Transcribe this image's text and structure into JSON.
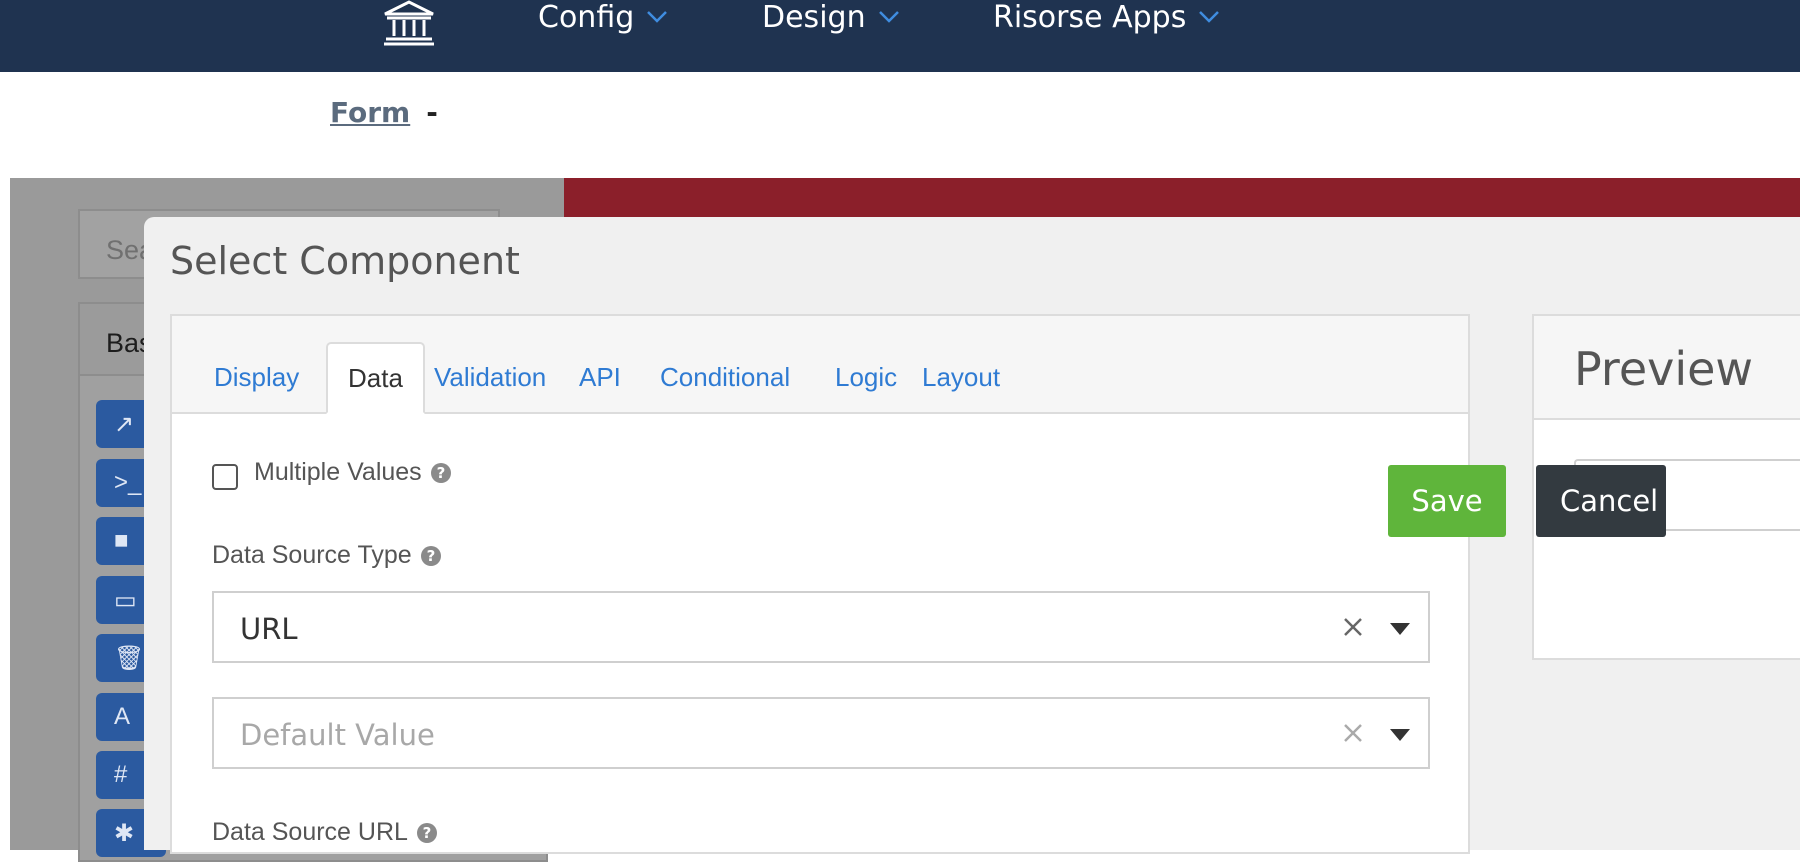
{
  "navbar": {
    "logo_icon": "bank-icon",
    "items": [
      {
        "label": "Config"
      },
      {
        "label": "Design"
      },
      {
        "label": "Risorse Apps"
      }
    ]
  },
  "breadcrumb": {
    "link": "Form",
    "separator": "-"
  },
  "builder": {
    "search_placeholder": "Sea",
    "group_label": "Bas",
    "component_icons": [
      {
        "icon": "external-link-icon",
        "glyph": "↗"
      },
      {
        "icon": "terminal-icon",
        "glyph": ">_"
      },
      {
        "icon": "square-icon",
        "glyph": "■"
      },
      {
        "icon": "window-icon",
        "glyph": "▭"
      },
      {
        "icon": "trash-icon",
        "glyph": "🗑"
      },
      {
        "icon": "font-icon",
        "glyph": "A"
      },
      {
        "icon": "hash-icon",
        "glyph": "#"
      },
      {
        "icon": "asterisk-icon",
        "glyph": "✱"
      }
    ],
    "colors": {
      "accent_bar": "#8b1f2a",
      "component_button": "#2b5aa0"
    }
  },
  "modal": {
    "title": "Select Component",
    "tabs": [
      {
        "label": "Display"
      },
      {
        "label": "Data"
      },
      {
        "label": "Validation"
      },
      {
        "label": "API"
      },
      {
        "label": "Conditional"
      },
      {
        "label": "Logic"
      },
      {
        "label": "Layout"
      }
    ],
    "active_tab": "Data",
    "fields": {
      "multiple_values": {
        "label": "Multiple Values",
        "checked": false
      },
      "data_source_type": {
        "label": "Data Source Type",
        "value": "URL"
      },
      "default_value": {
        "placeholder": "Default Value"
      },
      "data_source_url": {
        "label": "Data Source URL"
      }
    },
    "preview": {
      "title": "Preview"
    },
    "buttons": {
      "save": "Save",
      "cancel": "Cancel"
    },
    "colors": {
      "save": "#5fb53b",
      "cancel": "#333a40",
      "tab_link": "#2f7bd3",
      "navbar": "#1f3350"
    }
  }
}
